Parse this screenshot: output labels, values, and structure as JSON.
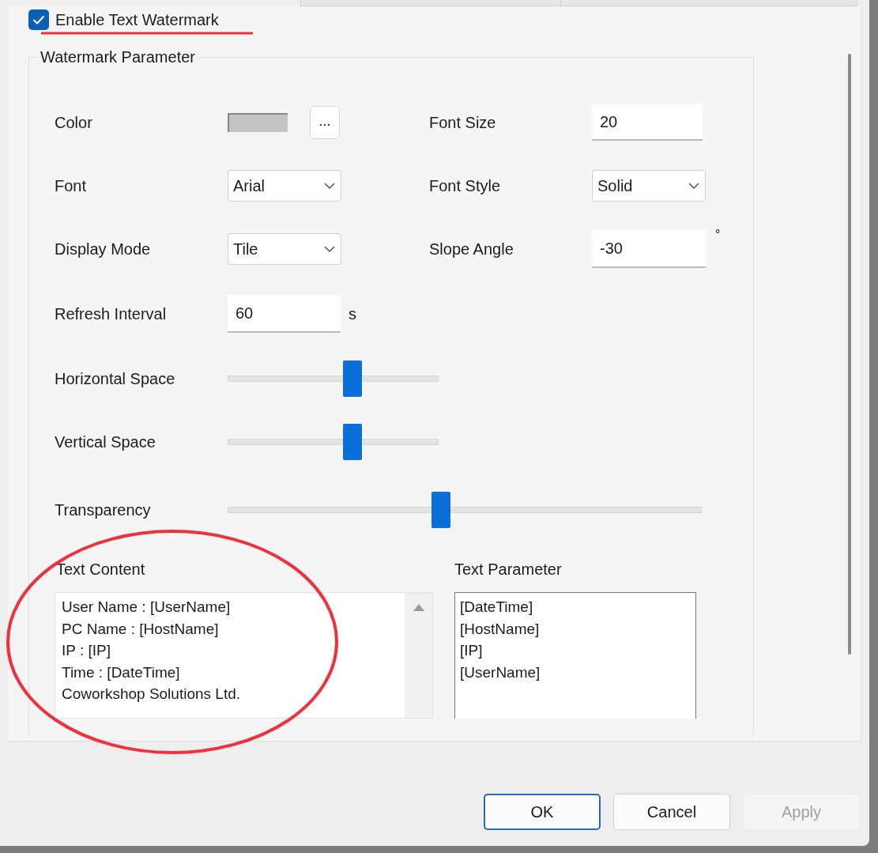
{
  "enable_watermark": {
    "label": "Enable Text Watermark",
    "checked": true
  },
  "group": {
    "title": "Watermark Parameter"
  },
  "color": {
    "label": "Color",
    "button": "..."
  },
  "font_size": {
    "label": "Font Size",
    "value": "20"
  },
  "font": {
    "label": "Font",
    "value": "Arial"
  },
  "font_style": {
    "label": "Font Style",
    "value": "Solid"
  },
  "display_mode": {
    "label": "Display Mode",
    "value": "Tile"
  },
  "slope_angle": {
    "label": "Slope Angle",
    "value": "-30",
    "unit": "°"
  },
  "refresh_interval": {
    "label": "Refresh Interval",
    "value": "60",
    "unit": "s"
  },
  "sliders": [
    {
      "label": "Horizontal Space",
      "kind": "short",
      "level": 0.59
    },
    {
      "label": "Vertical Space",
      "kind": "short",
      "level": 0.59
    },
    {
      "label": "Transparency",
      "kind": "wide",
      "level": 0.45
    }
  ],
  "text_content": {
    "label": "Text Content",
    "lines": [
      "User Name : [UserName]",
      "PC Name : [HostName]",
      "IP : [IP]",
      "Time : [DateTime]",
      "Coworkshop Solutions Ltd."
    ]
  },
  "text_parameter": {
    "label": "Text Parameter",
    "items": [
      "[DateTime]",
      "[HostName]",
      "[IP]",
      "[UserName]"
    ]
  },
  "buttons": [
    {
      "label": "OK",
      "kind": "default"
    },
    {
      "label": "Cancel",
      "kind": "normal"
    },
    {
      "label": "Apply",
      "kind": "disabled"
    }
  ]
}
